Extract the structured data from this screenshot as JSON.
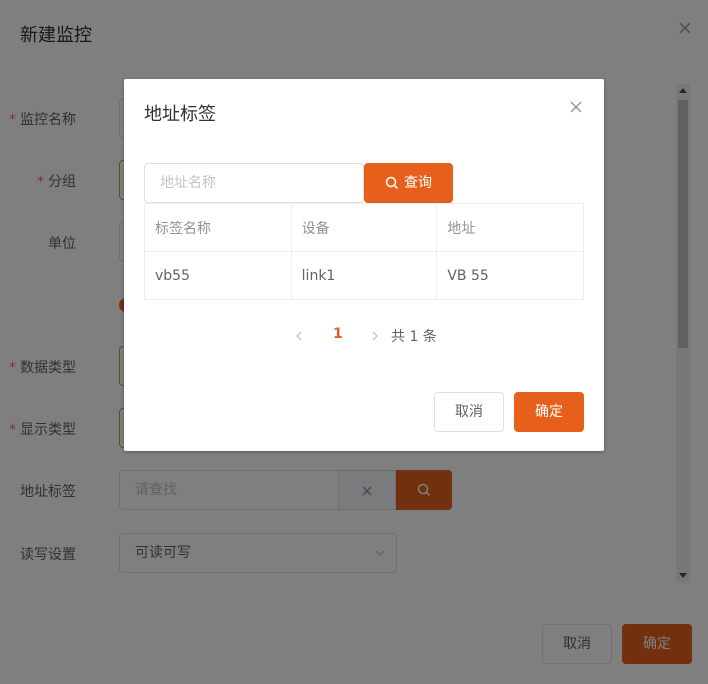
{
  "outer": {
    "title": "新建监控",
    "fields": [
      {
        "label": "监控名称",
        "required": true
      },
      {
        "label": "分组",
        "required": true
      },
      {
        "label": "单位",
        "required": false
      },
      {
        "label": "数据类型",
        "required": true
      },
      {
        "label": "显示类型",
        "required": true
      },
      {
        "label": "地址标签",
        "required": false,
        "placeholder": "请查找"
      },
      {
        "label": "读写设置",
        "required": false,
        "value": "可读可写"
      }
    ],
    "required_mark": "*",
    "cancel_label": "取消",
    "ok_label": "确定"
  },
  "dialog": {
    "title": "地址标签",
    "search_placeholder": "地址名称",
    "query_label": "查询",
    "table": {
      "headers": [
        "标签名称",
        "设备",
        "地址"
      ],
      "rows": [
        [
          "vb55",
          "link1",
          "VB 55"
        ]
      ]
    },
    "pagination": {
      "current_page": "1",
      "total_text": "共 1 条"
    },
    "cancel_label": "取消",
    "ok_label": "确定"
  },
  "colors": {
    "primary": "#e6601c",
    "success_border": "#67c23a",
    "required": "#f56c6c"
  }
}
